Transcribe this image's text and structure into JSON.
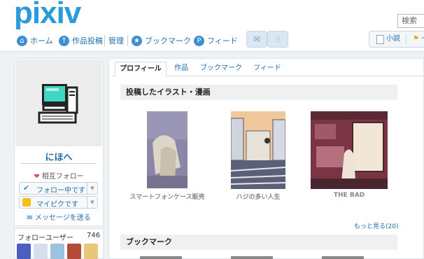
{
  "header": {
    "logo": "pixiv",
    "search_placeholder": "検索",
    "nav": [
      {
        "label": "ホーム",
        "icon": "home-icon"
      },
      {
        "label": "作品投稿",
        "icon": "upload-icon"
      },
      {
        "label": "管理"
      },
      {
        "label": "ブックマーク",
        "icon": "star-icon"
      },
      {
        "label": "フィード",
        "icon": "feed-icon"
      }
    ],
    "mail_icon": "mail-icon",
    "hand_icon": "hand-icon",
    "novel_label": "小説",
    "illust_label": "イ"
  },
  "profile": {
    "username": "にほへ",
    "mutual_label": "相互フォロー",
    "following_label": "フォロー中です",
    "mypic_label": "マイピクです",
    "message_label": "メッセージを送る",
    "follow_users_label": "フォローユーザー",
    "follow_users_count": "746"
  },
  "tabs": [
    "プロフィール",
    "作品",
    "ブックマーク",
    "フィード"
  ],
  "works": {
    "title": "投稿したイラスト・漫画",
    "items": [
      {
        "caption": "スマートフォンケース販売"
      },
      {
        "caption": "ハジの多い人生"
      },
      {
        "caption": "THE BAD"
      }
    ],
    "more_label": "もっと見る(20)"
  },
  "bookmarks": {
    "title": "ブックマーク"
  },
  "colors": {
    "brand": "#2b9bd9",
    "link": "#1f6fa8",
    "page_bg": "#eef1f5"
  }
}
